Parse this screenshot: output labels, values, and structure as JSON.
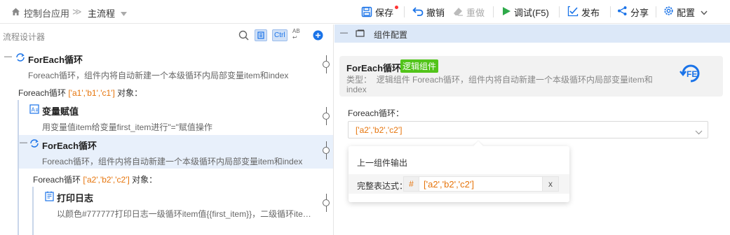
{
  "breadcrumb": {
    "home_label": "控制台应用",
    "sep": "≫",
    "current": "主流程"
  },
  "toolbar": {
    "save": "保存",
    "undo": "撤销",
    "redo": "重做",
    "debug": "调试(F5)",
    "publish": "发布",
    "share": "分享",
    "config": "配置"
  },
  "left_panel": {
    "title": "流程设计器",
    "ctrl_label": "Ctrl",
    "abc_label": "AB",
    "nodes": [
      {
        "title": "ForEach循环",
        "desc": "Foreach循环，组件内将自动新建一个本级循环内局部变量item和index"
      },
      {
        "title": "变量赋值",
        "desc": "用变量值item给变量first_item进行\"=\"赋值操作"
      },
      {
        "title": "ForEach循环",
        "desc": "Foreach循环，组件内将自动新建一个本级循环内局部变量item和index"
      },
      {
        "title": "打印日志",
        "desc": "以颜色#777777打印日志一级循环item值{{first_item}}，二级循环ite…"
      }
    ],
    "loop1": {
      "prefix": "Foreach循环 ",
      "value": "['a1','b1','c1']",
      "suffix": " 对象："
    },
    "loop2": {
      "prefix": "Foreach循环 ",
      "value": "['a2','b2','c2']",
      "suffix": " 对象："
    },
    "toggle_minus": "—"
  },
  "right_panel": {
    "header": "组件配置",
    "header_minus": "—",
    "card": {
      "title": "ForEach循环",
      "badge": "逻辑组件",
      "type_label": "类型：",
      "type_desc": "逻辑组件 Foreach循环，组件内将自动新建一个本级循环内局部变量item和index"
    },
    "field_label": "Foreach循环：",
    "field_value": "['a2','b2','c2']",
    "popup": {
      "title": "上一组件输出",
      "expr_label": "完整表达式：",
      "hash": "#",
      "expr_value": "['a2','b2','c2']",
      "close": "x"
    }
  },
  "colors": {
    "accent": "#1a73e8",
    "orange": "#e6740b",
    "green_badge": "#52c41a",
    "header_bg": "#dce8f8",
    "selected_row": "#e8f0fb"
  }
}
